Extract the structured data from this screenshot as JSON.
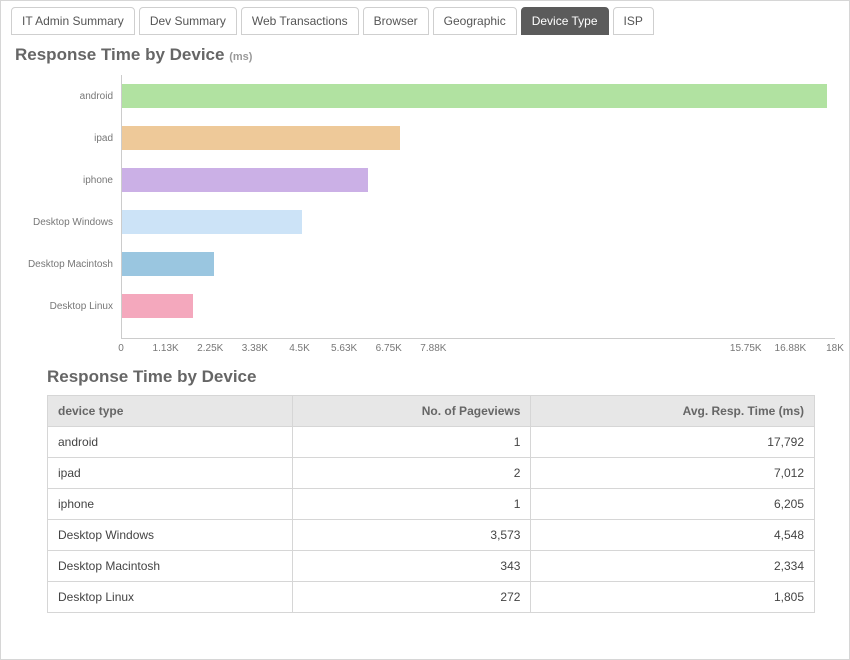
{
  "tabs": [
    {
      "label": "IT Admin Summary",
      "active": false
    },
    {
      "label": "Dev Summary",
      "active": false
    },
    {
      "label": "Web Transactions",
      "active": false
    },
    {
      "label": "Browser",
      "active": false
    },
    {
      "label": "Geographic",
      "active": false
    },
    {
      "label": "Device Type",
      "active": true
    },
    {
      "label": "ISP",
      "active": false
    }
  ],
  "chart": {
    "title": "Response Time by Device",
    "unit": "(ms)"
  },
  "chart_data": {
    "type": "bar",
    "orientation": "horizontal",
    "title": "Response Time by Device (ms)",
    "xlabel": "",
    "ylabel": "",
    "categories": [
      "android",
      "ipad",
      "iphone",
      "Desktop Windows",
      "Desktop Macintosh",
      "Desktop Linux"
    ],
    "values": [
      17792,
      7012,
      6205,
      4548,
      2334,
      1805
    ],
    "colors": [
      "#b1e2a1",
      "#eec999",
      "#cbb0e6",
      "#cce3f7",
      "#9ac6e0",
      "#f4a8bd"
    ],
    "x_ticks": [
      {
        "pos": 0.0,
        "label": "0"
      },
      {
        "pos": 0.0625,
        "label": "1.13K"
      },
      {
        "pos": 0.125,
        "label": "2.25K"
      },
      {
        "pos": 0.1875,
        "label": "3.38K"
      },
      {
        "pos": 0.25,
        "label": "4.5K"
      },
      {
        "pos": 0.3125,
        "label": "5.63K"
      },
      {
        "pos": 0.375,
        "label": "6.75K"
      },
      {
        "pos": 0.4375,
        "label": "7.88K"
      },
      {
        "pos": 0.875,
        "label": "15.75K"
      },
      {
        "pos": 0.9375,
        "label": "16.88K"
      },
      {
        "pos": 1.0,
        "label": "18K"
      }
    ],
    "xlim": [
      0,
      18000
    ]
  },
  "table": {
    "title": "Response Time by Device",
    "columns": [
      "device type",
      "No. of Pageviews",
      "Avg. Resp. Time (ms)"
    ],
    "rows": [
      {
        "device": "android",
        "pageviews": "1",
        "resp": "17,792"
      },
      {
        "device": "ipad",
        "pageviews": "2",
        "resp": "7,012"
      },
      {
        "device": "iphone",
        "pageviews": "1",
        "resp": "6,205"
      },
      {
        "device": "Desktop Windows",
        "pageviews": "3,573",
        "resp": "4,548"
      },
      {
        "device": "Desktop Macintosh",
        "pageviews": "343",
        "resp": "2,334"
      },
      {
        "device": "Desktop Linux",
        "pageviews": "272",
        "resp": "1,805"
      }
    ]
  }
}
